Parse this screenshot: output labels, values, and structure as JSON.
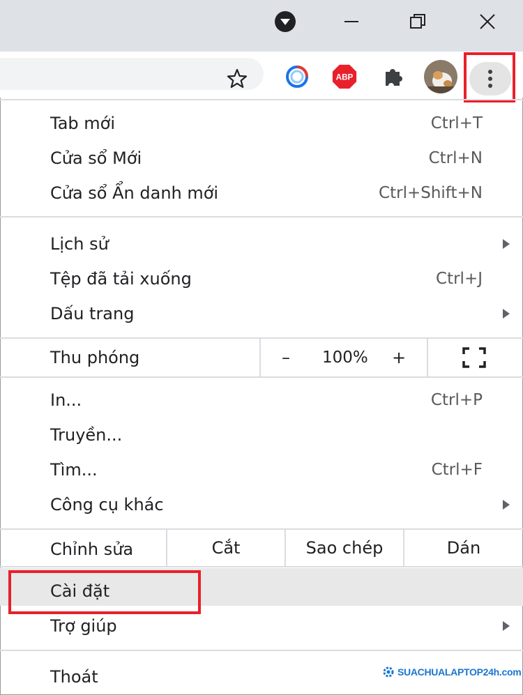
{
  "window": {
    "controls": [
      "minimize",
      "restore",
      "close"
    ]
  },
  "toolbar": {
    "extensions": [
      {
        "icon": "sync-ring-icon"
      },
      {
        "icon": "adblock-plus-icon",
        "text": "ABP"
      },
      {
        "icon": "puzzle-icon"
      },
      {
        "icon": "profile-avatar"
      }
    ]
  },
  "menu": {
    "group1": [
      {
        "label": "Tab mới",
        "shortcut": "Ctrl+T"
      },
      {
        "label": "Cửa sổ Mới",
        "shortcut": "Ctrl+N"
      },
      {
        "label": "Cửa sổ Ẩn danh mới",
        "shortcut": "Ctrl+Shift+N"
      }
    ],
    "group2": [
      {
        "label": "Lịch sử",
        "submenu": true
      },
      {
        "label": "Tệp đã tải xuống",
        "shortcut": "Ctrl+J"
      },
      {
        "label": "Dấu trang",
        "submenu": true
      }
    ],
    "zoom": {
      "label": "Thu phóng",
      "minus": "–",
      "value": "100%",
      "plus": "+"
    },
    "group3": [
      {
        "label": "In...",
        "shortcut": "Ctrl+P"
      },
      {
        "label": "Truyền..."
      },
      {
        "label": "Tìm...",
        "shortcut": "Ctrl+F"
      },
      {
        "label": "Công cụ khác",
        "submenu": true
      }
    ],
    "edit": {
      "label": "Chỉnh sửa",
      "cut": "Cắt",
      "copy": "Sao chép",
      "paste": "Dán"
    },
    "group4": [
      {
        "label": "Cài đặt",
        "highlighted": true
      },
      {
        "label": "Trợ giúp",
        "submenu": true
      }
    ],
    "exit": {
      "label": "Thoát"
    }
  },
  "watermark": {
    "text_main": "SUACHUALAPTOP",
    "text_accent": "24h.com"
  },
  "colors": {
    "highlight_border": "#e8202a",
    "titlebar": "#dee1e6",
    "hover": "#e8e8e8"
  }
}
